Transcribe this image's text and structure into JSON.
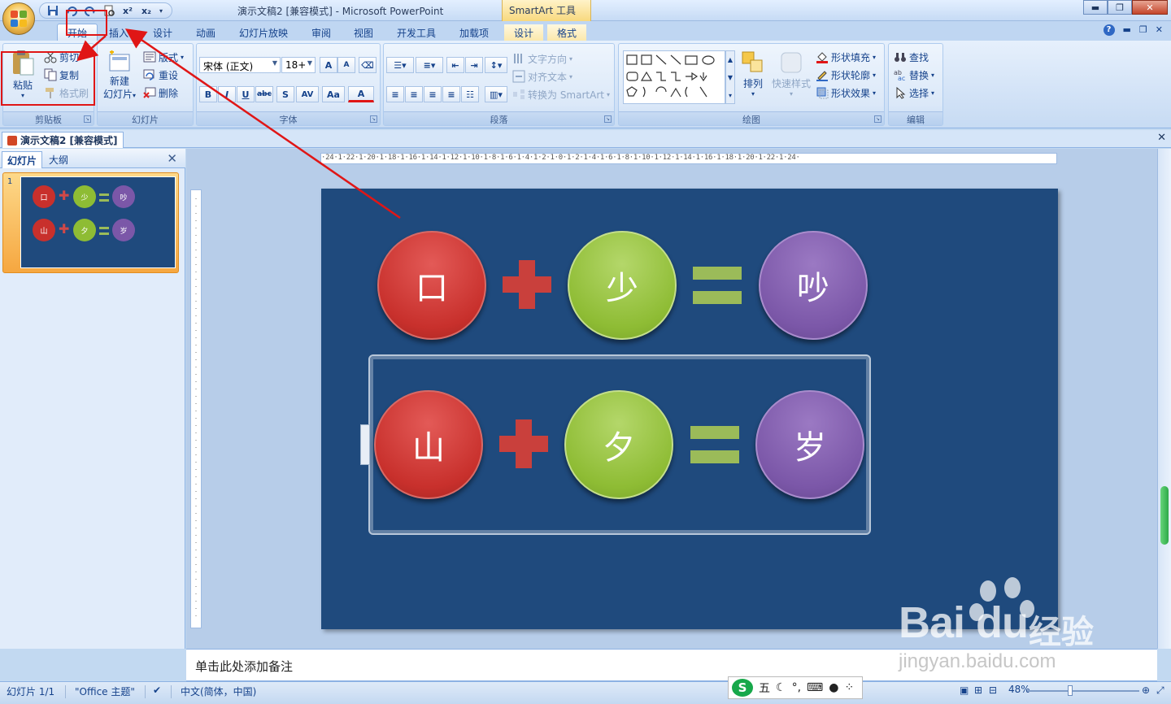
{
  "window": {
    "title": "演示文稿2 [兼容模式] - Microsoft PowerPoint",
    "contextual_tab": "SmartArt 工具"
  },
  "quick_access": [
    "save-icon",
    "undo-icon",
    "redo-icon",
    "x²",
    "x₂"
  ],
  "tabs": [
    {
      "label": "开始",
      "active": true
    },
    {
      "label": "插入"
    },
    {
      "label": "设计"
    },
    {
      "label": "动画"
    },
    {
      "label": "幻灯片放映"
    },
    {
      "label": "审阅"
    },
    {
      "label": "视图"
    },
    {
      "label": "开发工具"
    },
    {
      "label": "加载项"
    },
    {
      "label": "设计",
      "contextual": true
    },
    {
      "label": "格式",
      "contextual": true
    }
  ],
  "ribbon": {
    "clipboard": {
      "label": "剪贴板",
      "paste": "粘贴",
      "cut": "剪切",
      "copy": "复制",
      "format_painter": "格式刷"
    },
    "slides": {
      "label": "幻灯片",
      "new_slide_1": "新建",
      "new_slide_2": "幻灯片",
      "layout": "版式",
      "reset": "重设",
      "delete": "删除"
    },
    "font": {
      "label": "字体",
      "font_name": "宋体 (正文)",
      "font_size": "18+",
      "grow": "A",
      "shrink": "A",
      "bold": "B",
      "italic": "I",
      "underline": "U",
      "strike": "abc",
      "shadow": "S",
      "spacing": "AV",
      "case": "Aa",
      "color": "A"
    },
    "paragraph": {
      "label": "段落",
      "text_direction": "文字方向",
      "align_text": "对齐文本",
      "convert_smartart": "转换为 SmartArt"
    },
    "drawing": {
      "label": "绘图",
      "arrange": "排列",
      "quick_styles": "快速样式",
      "shape_fill": "形状填充",
      "shape_outline": "形状轮廓",
      "shape_effects": "形状效果"
    },
    "editing": {
      "label": "编辑",
      "find": "查找",
      "replace": "替换",
      "select": "选择"
    }
  },
  "doc_tab": "演示文稿2 [兼容模式]",
  "left_pane": {
    "tab_slides": "幻灯片",
    "tab_outline": "大纲",
    "slide_number": "1"
  },
  "ruler_text": "·24·1·22·1·20·1·18·1·16·1·14·1·12·1·10·1·8·1·6·1·4·1·2·1·0·1·2·1·4·1·6·1·8·1·10·1·12·1·14·1·16·1·18·1·20·1·22·1·24·",
  "slide": {
    "row1": {
      "a": "口",
      "b": "少",
      "c": "吵"
    },
    "row2": {
      "a": "山",
      "b": "夕",
      "c": "岁"
    }
  },
  "notes_placeholder": "单击此处添加备注",
  "status": {
    "slide": "幻灯片 1/1",
    "theme": "\"Office 主题\"",
    "language": "中文(简体，中国)",
    "ime": "五",
    "zoom": "48%"
  },
  "colors": {
    "slide_bg": "#1f4a7d",
    "red": "#c8302c",
    "green": "#8ebc34",
    "purple": "#7b57a8",
    "annotation": "#e01616"
  },
  "watermark": {
    "brand": "Bai du",
    "cn": "经验",
    "url": "jingyan.baidu.com"
  }
}
